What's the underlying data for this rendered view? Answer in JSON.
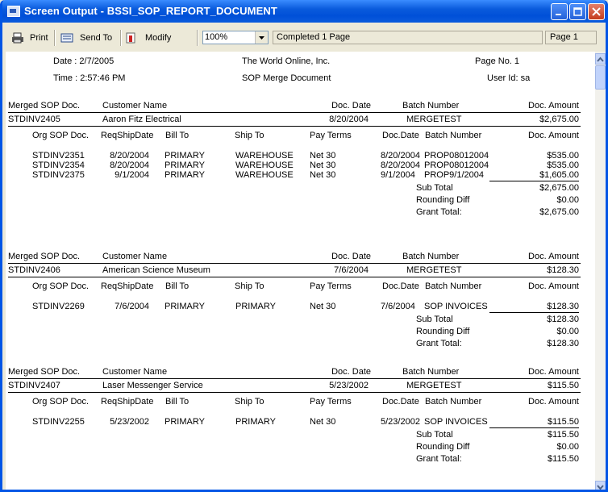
{
  "window": {
    "title": "Screen Output - BSSI_SOP_REPORT_DOCUMENT"
  },
  "toolbar": {
    "print_label": "Print",
    "sendto_label": "Send To",
    "modify_label": "Modify",
    "zoom_value": "100%",
    "status_text": "Completed 1 Page",
    "page_text": "Page 1"
  },
  "header": {
    "date": "Date : 2/7/2005",
    "time": "Time : 2:57:46 PM",
    "company": "The World Online, Inc.",
    "report": "SOP Merge Document",
    "page_no": "Page No. 1",
    "user_id": "User Id: sa"
  },
  "cols_main": [
    "Merged SOP Doc.",
    "Customer Name",
    "Doc. Date",
    "Batch Number",
    "Doc. Amount"
  ],
  "cols_sub": [
    "Org SOP Doc.",
    "ReqShipDate",
    "Bill To",
    "Ship To",
    "Pay Terms",
    "Doc.Date",
    "Batch Number",
    "Doc. Amount"
  ],
  "totals_labels": [
    "Sub Total",
    "Rounding Diff",
    "Grant Total:"
  ],
  "groups": [
    {
      "merged": "STDINV2405",
      "customer": "Aaron Fitz Electrical",
      "date": "8/20/2004",
      "batch": "MERGETEST",
      "amount": "$2,675.00",
      "lines": [
        {
          "org": "STDINV2351",
          "req": "8/20/2004",
          "bill": "PRIMARY",
          "ship": "WAREHOUSE",
          "terms": "Net 30",
          "ddate": "8/20/2004",
          "batch": "PROP08012004",
          "amt": "$535.00"
        },
        {
          "org": "STDINV2354",
          "req": "8/20/2004",
          "bill": "PRIMARY",
          "ship": "WAREHOUSE",
          "terms": "Net 30",
          "ddate": "8/20/2004",
          "batch": "PROP08012004",
          "amt": "$535.00"
        },
        {
          "org": "STDINV2375",
          "req": "9/1/2004",
          "bill": "PRIMARY",
          "ship": "WAREHOUSE",
          "terms": "Net 30",
          "ddate": "9/1/2004",
          "batch": "PROP9/1/2004",
          "amt": "$1,605.00"
        }
      ],
      "subtotal": "$2,675.00",
      "rounding": "$0.00",
      "grand": "$2,675.00"
    },
    {
      "merged": "STDINV2406",
      "customer": "American Science Museum",
      "date": "7/6/2004",
      "batch": "MERGETEST",
      "amount": "$128.30",
      "lines": [
        {
          "org": "STDINV2269",
          "req": "7/6/2004",
          "bill": "PRIMARY",
          "ship": "PRIMARY",
          "terms": "Net 30",
          "ddate": "7/6/2004",
          "batch": "SOP INVOICES",
          "amt": "$128.30"
        }
      ],
      "subtotal": "$128.30",
      "rounding": "$0.00",
      "grand": "$128.30"
    },
    {
      "merged": "STDINV2407",
      "customer": "Laser Messenger Service",
      "date": "5/23/2002",
      "batch": "MERGETEST",
      "amount": "$115.50",
      "lines": [
        {
          "org": "STDINV2255",
          "req": "5/23/2002",
          "bill": "PRIMARY",
          "ship": "PRIMARY",
          "terms": "Net 30",
          "ddate": "5/23/2002",
          "batch": "SOP INVOICES",
          "amt": "$115.50"
        }
      ],
      "subtotal": "$115.50",
      "rounding": "$0.00",
      "grand": "$115.50"
    }
  ]
}
